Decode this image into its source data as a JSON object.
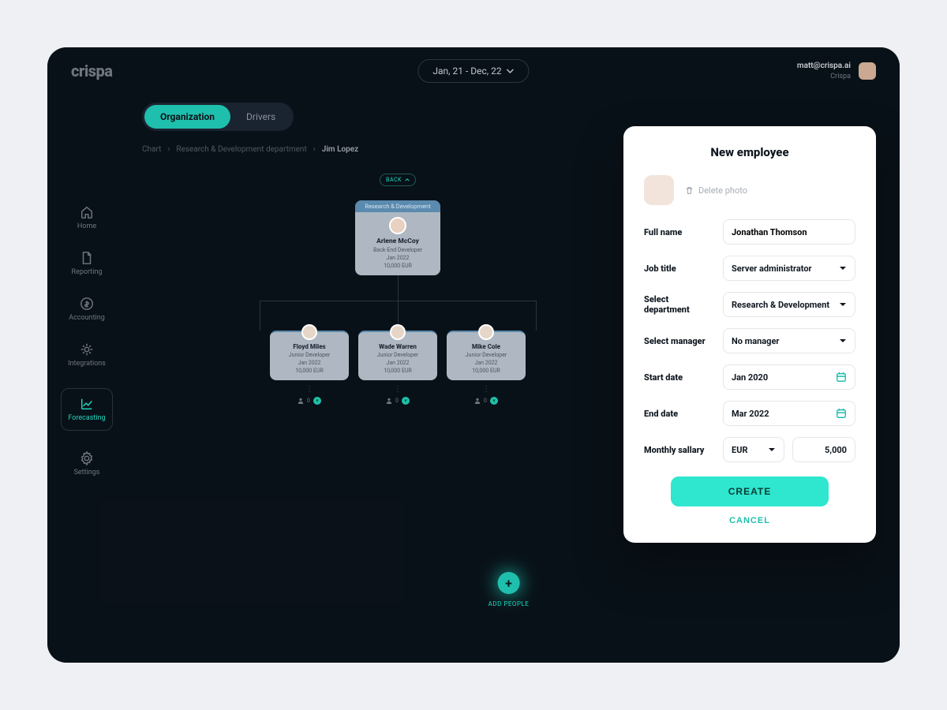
{
  "brand": "crispa",
  "header": {
    "range": "Jan, 21 - Dec, 22",
    "user_email": "matt@crispa.ai",
    "user_org": "Crispa"
  },
  "sidebar": {
    "items": [
      {
        "label": "Home"
      },
      {
        "label": "Reporting"
      },
      {
        "label": "Accounting"
      },
      {
        "label": "Integrations"
      },
      {
        "label": "Forecasting"
      },
      {
        "label": "Settings"
      }
    ]
  },
  "tabs": {
    "organization": "Organization",
    "drivers": "Drivers"
  },
  "breadcrumb": {
    "a": "Chart",
    "b": "Research & Development department",
    "c": "Jim Lopez"
  },
  "back_chip": "BACK",
  "parent": {
    "dept": "Research & Development",
    "name": "Arlene McCoy",
    "role": "Back-End Developer",
    "date": "Jan 2022",
    "money": "10,000 EUR"
  },
  "children": [
    {
      "name": "Floyd Miles",
      "role": "Junior Developer",
      "date": "Jan 2022",
      "money": "10,000 EUR",
      "count": "0"
    },
    {
      "name": "Wade Warren",
      "role": "Junior Developer",
      "date": "Jan 2022",
      "money": "10,000 EUR",
      "count": "0"
    },
    {
      "name": "Mike Cole",
      "role": "Junior Developer",
      "date": "Jan 2022",
      "money": "10,000 EUR",
      "count": "0"
    }
  ],
  "add_label": "ADD PEOPLE",
  "modal": {
    "title": "New employee",
    "delete_photo": "Delete photo",
    "labels": {
      "full_name": "Full name",
      "job_title": "Job title",
      "department": "Select department",
      "manager": "Select manager",
      "start": "Start date",
      "end": "End date",
      "salary": "Monthly sallary"
    },
    "values": {
      "full_name": "Jonathan Thomson",
      "job_title": "Server administrator",
      "department": "Research & Development",
      "manager": "No manager",
      "start": "Jan 2020",
      "end": "Mar 2022",
      "currency": "EUR",
      "amount": "5,000"
    },
    "create": "CREATE",
    "cancel": "CANCEL"
  }
}
